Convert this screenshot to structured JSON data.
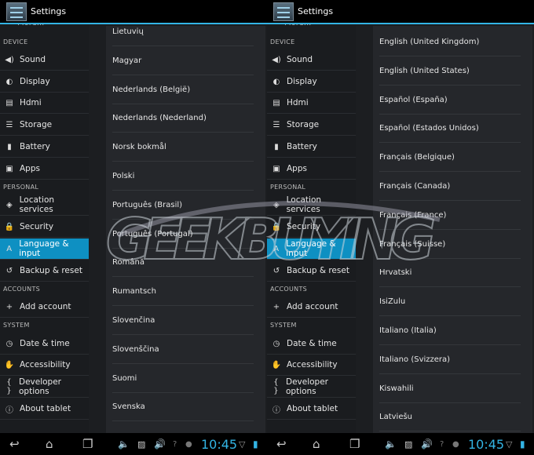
{
  "app_title": "Settings",
  "sidebar": {
    "more": "More...",
    "items": [
      {
        "type": "header",
        "label": "DEVICE"
      },
      {
        "type": "item",
        "label": "Sound",
        "icon": "speaker-icon"
      },
      {
        "type": "item",
        "label": "Display",
        "icon": "brightness-icon"
      },
      {
        "type": "item",
        "label": "Hdmi",
        "icon": "hdmi-icon"
      },
      {
        "type": "item",
        "label": "Storage",
        "icon": "storage-icon"
      },
      {
        "type": "item",
        "label": "Battery",
        "icon": "battery-icon"
      },
      {
        "type": "item",
        "label": "Apps",
        "icon": "apps-icon"
      },
      {
        "type": "header",
        "label": "PERSONAL"
      },
      {
        "type": "item",
        "label": "Location services",
        "icon": "location-icon"
      },
      {
        "type": "item",
        "label": "Security",
        "icon": "lock-icon"
      },
      {
        "type": "item",
        "label": "Language & input",
        "icon": "language-icon",
        "selected": true
      },
      {
        "type": "item",
        "label": "Backup & reset",
        "icon": "backup-icon"
      },
      {
        "type": "header",
        "label": "ACCOUNTS"
      },
      {
        "type": "item",
        "label": "Add account",
        "icon": "plus-icon"
      },
      {
        "type": "header",
        "label": "SYSTEM"
      },
      {
        "type": "item",
        "label": "Date & time",
        "icon": "clock-icon"
      },
      {
        "type": "item",
        "label": "Accessibility",
        "icon": "hand-icon"
      },
      {
        "type": "item",
        "label": "Developer options",
        "icon": "braces-icon"
      },
      {
        "type": "item",
        "label": "About tablet",
        "icon": "info-icon"
      }
    ]
  },
  "panels": [
    {
      "languages": [
        "Lietuvių",
        "Magyar",
        "Nederlands (België)",
        "Nederlands (Nederland)",
        "Norsk bokmål",
        "Polski",
        "Português (Brasil)",
        "Português (Portugal)",
        "Română",
        "Rumantsch",
        "Slovenčina",
        "Slovenščina",
        "Suomi",
        "Svenska"
      ]
    },
    {
      "languages": [
        "English (United Kingdom)",
        "English (United States)",
        "Español (España)",
        "Español (Estados Unidos)",
        "Français (Belgique)",
        "Français (Canada)",
        "Français (France)",
        "Français (Suisse)",
        "Hrvatski",
        "IsiZulu",
        "Italiano (Italia)",
        "Italiano (Svizzera)",
        "Kiswahili",
        "Latviešu"
      ]
    }
  ],
  "status": {
    "time": "10:45"
  },
  "watermark": "GEEKBUYING",
  "colors": {
    "accent": "#33b5e5",
    "selected": "#0e90c2"
  }
}
